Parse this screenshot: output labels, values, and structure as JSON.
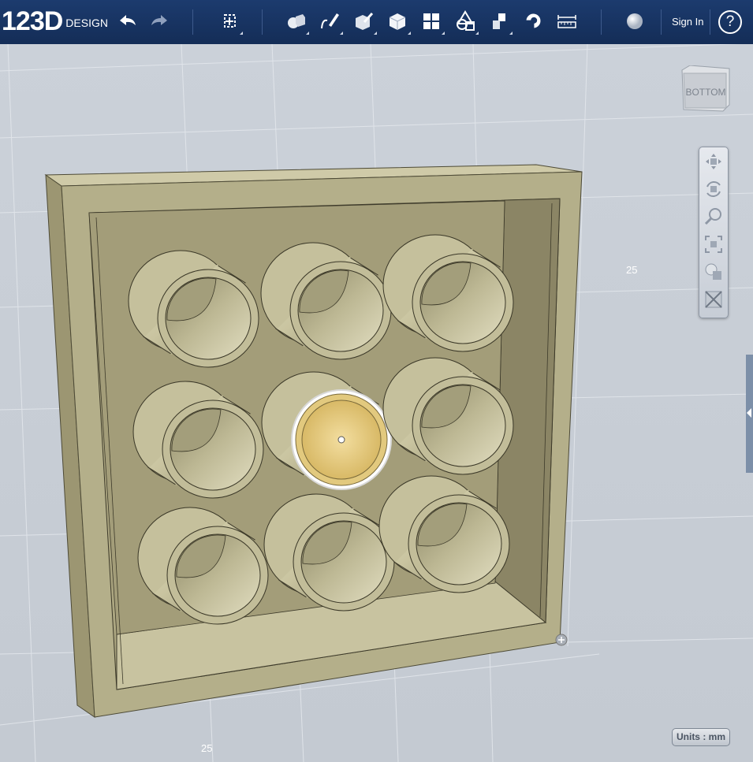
{
  "app": {
    "logo_main": "123D",
    "logo_sub": "DESIGN"
  },
  "toolbar": {
    "tools": [
      "undo-icon",
      "redo-icon",
      "transform-icon",
      "primitives-icon",
      "sketch-icon",
      "construct-icon",
      "modify-icon",
      "pattern-icon",
      "grouping-icon",
      "combine-icon",
      "snap-icon",
      "measure-icon",
      "material-icon"
    ],
    "sign_in": "Sign In",
    "help": "?"
  },
  "viewport": {
    "grid_label_right": "25",
    "grid_label_bottom": "25",
    "viewcube_face": "BOTTOM",
    "units": "Units : mm"
  },
  "colors": {
    "toolbar_bg": "#142d57",
    "model_face": "#b5b08c",
    "model_light": "#d8d4b2",
    "selection": "#e8c877",
    "viewport_bg": "#c9cfd7"
  }
}
